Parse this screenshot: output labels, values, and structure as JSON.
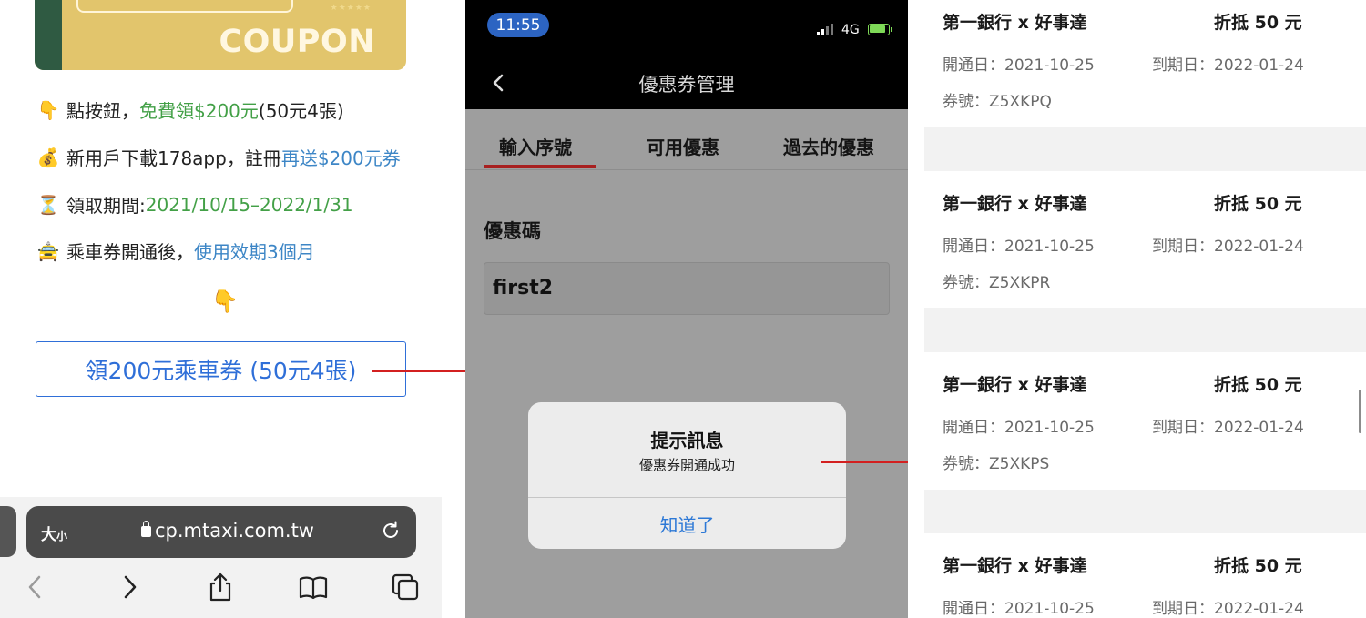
{
  "panel1": {
    "coupon_banner_text": "COUPON",
    "coupon_stars": "★★★★★",
    "lines": [
      {
        "emoji": "👇",
        "parts": [
          {
            "text": "點按鈕，",
            "color": "default"
          },
          {
            "text": "免費領$200元",
            "color": "green"
          },
          {
            "text": " (50元4張)",
            "color": "default"
          }
        ]
      },
      {
        "emoji": "💰",
        "parts": [
          {
            "text": "新用戶下載178app，註冊",
            "color": "default"
          },
          {
            "text": "再送$200元券",
            "color": "blue"
          }
        ]
      },
      {
        "emoji": "⏳",
        "parts": [
          {
            "text": "領取期間: ",
            "color": "default"
          },
          {
            "text": "2021/10/15–2022/1/31",
            "color": "green"
          }
        ]
      },
      {
        "emoji": "🚖",
        "parts": [
          {
            "text": "乘車券開通後，",
            "color": "default"
          },
          {
            "text": "使用效期3個月",
            "color": "blue"
          }
        ]
      }
    ],
    "pointer_emoji": "👇",
    "claim_button_label": "領200元乘車券 (50元4張)",
    "safari": {
      "text_size_label": "大",
      "text_size_small": "小",
      "url": "cp.mtaxi.com.tw"
    }
  },
  "panel2": {
    "status_time": "11:55",
    "network": "4G",
    "nav_title": "優惠券管理",
    "tabs": [
      "輸入序號",
      "可用優惠",
      "過去的優惠"
    ],
    "active_tab": 0,
    "code_label": "優惠碼",
    "code_value": "first2",
    "dialog": {
      "title": "提示訊息",
      "message": "優惠券開通成功",
      "button": "知道了"
    }
  },
  "panel3": {
    "coupons": [
      {
        "title": "第一銀行 x 好事達",
        "amount": "折抵 50 元",
        "start_label": "開通日：2021-10-25",
        "end_label": "到期日：2022-01-24",
        "code_label": "券號：Z5XKPQ"
      },
      {
        "title": "第一銀行 x 好事達",
        "amount": "折抵 50 元",
        "start_label": "開通日：2021-10-25",
        "end_label": "到期日：2022-01-24",
        "code_label": "券號：Z5XKPR"
      },
      {
        "title": "第一銀行 x 好事達",
        "amount": "折抵 50 元",
        "start_label": "開通日：2021-10-25",
        "end_label": "到期日：2022-01-24",
        "code_label": "券號：Z5XKPS"
      },
      {
        "title": "第一銀行 x 好事達",
        "amount": "折抵 50 元",
        "start_label": "開通日：2021-10-25",
        "end_label": "到期日：2022-01-24"
      }
    ]
  },
  "colors": {
    "accent_blue": "#2f6fd8",
    "accent_green": "#43a047",
    "link_blue": "#3d86c6",
    "tab_underline": "#a82020",
    "annotation_arrow": "#d32020",
    "coupon_gold": "#e2c56c",
    "coupon_green": "#2f5a42"
  },
  "icons": [
    "chevron-left-icon",
    "chevron-right-icon",
    "share-icon",
    "bookmarks-icon",
    "tabs-icon",
    "reload-icon",
    "lock-icon",
    "back-icon",
    "battery-icon",
    "signal-icon"
  ]
}
